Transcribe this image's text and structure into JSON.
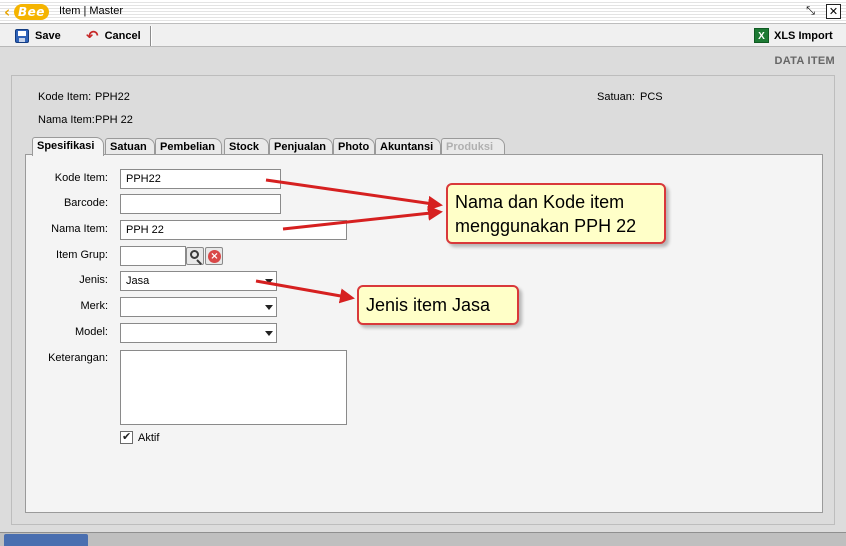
{
  "window": {
    "logo_text": "Bee",
    "title": "Item | Master",
    "restore_glyph": "⤡",
    "close_glyph": "✕"
  },
  "toolbar": {
    "save_label": "Save",
    "cancel_label": "Cancel",
    "xls_label": "XLS Import",
    "xls_icon_text": "X"
  },
  "section_title": "DATA ITEM",
  "header": {
    "kode_label": "Kode Item:",
    "kode_value": "PPH22",
    "nama_label": "Nama Item:",
    "nama_value": "PPH 22",
    "satuan_label": "Satuan:",
    "satuan_value": "PCS"
  },
  "tabs": [
    {
      "label": "Spesifikasi",
      "state": "active"
    },
    {
      "label": "Satuan",
      "state": "normal"
    },
    {
      "label": "Pembelian",
      "state": "normal"
    },
    {
      "label": "Stock",
      "state": "normal"
    },
    {
      "label": "Penjualan",
      "state": "normal"
    },
    {
      "label": "Photo",
      "state": "normal"
    },
    {
      "label": "Akuntansi",
      "state": "normal"
    },
    {
      "label": "Produksi",
      "state": "disabled"
    }
  ],
  "form": {
    "kode_label": "Kode Item:",
    "kode_value": "PPH22",
    "barcode_label": "Barcode:",
    "barcode_value": "",
    "nama_label": "Nama Item:",
    "nama_value": "PPH 22",
    "grup_label": "Item Grup:",
    "grup_value": "",
    "jenis_label": "Jenis:",
    "jenis_value": "Jasa",
    "merk_label": "Merk:",
    "merk_value": "",
    "model_label": "Model:",
    "model_value": "",
    "keterangan_label": "Keterangan:",
    "keterangan_value": "",
    "aktif_label": "Aktif",
    "aktif_checked": true
  },
  "callouts": {
    "first": "Nama dan Kode item menggunakan PPH 22",
    "second": "Jenis item Jasa"
  },
  "colors": {
    "callout_fill": "#ffffc8",
    "callout_border": "#d9383a",
    "arrow": "#d62020",
    "logo": "#f5b400"
  }
}
